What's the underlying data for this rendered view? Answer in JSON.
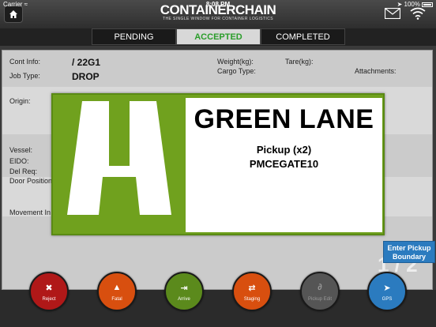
{
  "status_bar": {
    "carrier": "Carrier",
    "time": "8:08 PM",
    "battery": "100%"
  },
  "header": {
    "logo_name": "CONTAINERCHAIN",
    "logo_tagline": "THE SINGLE WINDOW FOR CONTAINER LOGISTICS",
    "icons": [
      "home-icon",
      "mail-icon",
      "wifi-icon"
    ]
  },
  "tabs": [
    {
      "label": "PENDING",
      "active": false
    },
    {
      "label": "ACCEPTED",
      "active": true
    },
    {
      "label": "COMPLETED",
      "active": false
    }
  ],
  "job": {
    "cont_info_label": "Cont Info:",
    "cont_info_value": "/ 22G1",
    "job_type_label": "Job Type:",
    "job_type_value": "DROP",
    "weight_label": "Weight(kg):",
    "tare_label": "Tare(kg):",
    "cargo_type_label": "Cargo Type:",
    "attachments_label": "Attachments:",
    "origin_label": "Origin:",
    "vessel_label": "Vessel:",
    "eido_label": "EIDO:",
    "del_req_label": "Del Req:",
    "door_position_label": "Door Position",
    "movement_label": "Movement In",
    "page_indicator": "1 / 2"
  },
  "modal": {
    "lane_name": "GREEN LANE",
    "pickup_line": "Pickup (x2)",
    "gate_code": "PMCEGATE10",
    "logo_color": "#70a11e"
  },
  "boundary_button": {
    "label": "Enter Pickup Boundary"
  },
  "actions": [
    {
      "label": "Reject",
      "icon": "x-icon",
      "color": "#b01818"
    },
    {
      "label": "Fatal",
      "icon": "warning-icon",
      "color": "#d84f0f"
    },
    {
      "label": "Arrive",
      "icon": "arrive-icon",
      "color": "#5b8a1c"
    },
    {
      "label": "Staging",
      "icon": "shuffle-icon",
      "color": "#d84f0f"
    },
    {
      "label": "Pickup Edit",
      "icon": "paperclip-icon",
      "color": "#555555"
    },
    {
      "label": "GPS",
      "icon": "location-arrow-icon",
      "color": "#2b7bbf"
    }
  ]
}
